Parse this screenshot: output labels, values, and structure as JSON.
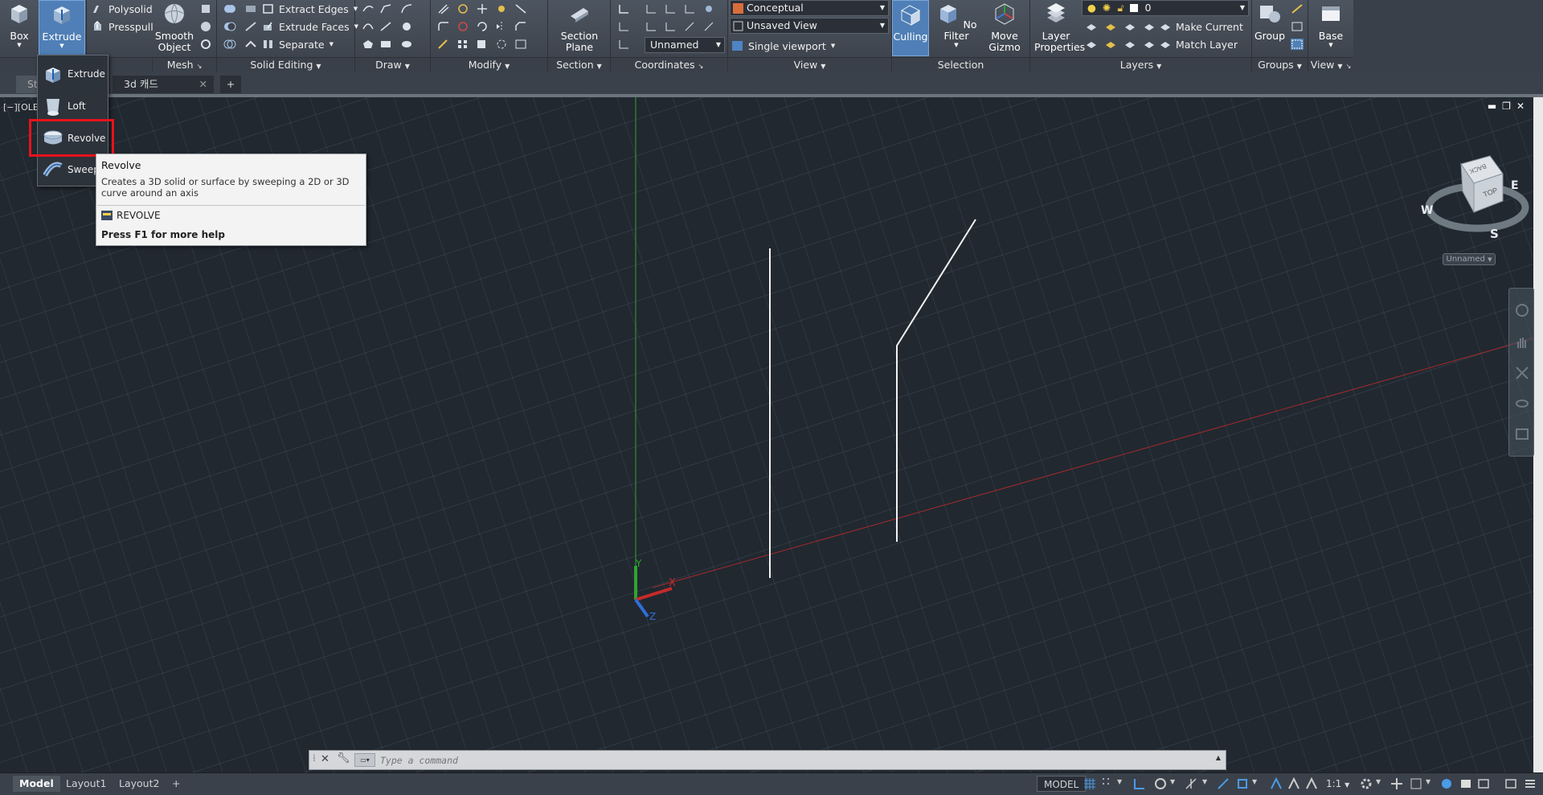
{
  "ribbon": {
    "panels": {
      "modeling": {
        "box_label": "Box",
        "extrude_label": "Extrude",
        "polysolid_label": "Polysolid",
        "presspull_label": "Presspull"
      },
      "mesh": {
        "title": "Mesh",
        "smooth_object_label": "Smooth Object"
      },
      "solid_editing": {
        "title": "Solid Editing",
        "extract_edges_label": "Extract Edges",
        "extrude_faces_label": "Extrude Faces",
        "separate_label": "Separate"
      },
      "draw": {
        "title": "Draw"
      },
      "modify": {
        "title": "Modify"
      },
      "section": {
        "title": "Section",
        "section_plane_label": "Section Plane"
      },
      "coordinates": {
        "title": "Coordinates",
        "ucs_combo": "Unnamed"
      },
      "view": {
        "title": "View",
        "visual_style": "Conceptual",
        "named_view": "Unsaved View",
        "viewport_config": "Single viewport"
      },
      "selection": {
        "title": "Selection",
        "culling_label": "Culling",
        "no_filter_label": "No Filter",
        "move_gizmo_label": "Move Gizmo"
      },
      "layers": {
        "title": "Layers",
        "layer_properties_label": "Layer Properties",
        "current_layer": "0",
        "make_current_label": "Make Current",
        "match_layer_label": "Match Layer"
      },
      "groups": {
        "title": "Groups",
        "group_label": "Group"
      },
      "view2": {
        "title": "View",
        "base_label": "Base"
      }
    }
  },
  "doc_tabs": {
    "start_label": "Start",
    "file_label": "3d 캐드"
  },
  "viewport": {
    "label": "[−][OLE"
  },
  "flyout": {
    "items": [
      "Extrude",
      "Loft",
      "Revolve",
      "Sweep"
    ]
  },
  "tooltip": {
    "title": "Revolve",
    "description": "Creates a 3D solid or surface by sweeping a 2D or 3D curve around an axis",
    "command": "REVOLVE",
    "help": "Press F1 for more help"
  },
  "viewcube": {
    "faces": {
      "top": "TOP",
      "back": "BACK"
    },
    "compass": {
      "west": "W",
      "east": "E",
      "south": "S"
    },
    "ucs_label": "Unnamed"
  },
  "ucs_icon": {
    "x": "X",
    "y": "Y",
    "z": "Z"
  },
  "command_line": {
    "placeholder": "Type a command"
  },
  "status": {
    "layout_tabs": [
      "Model",
      "Layout1",
      "Layout2"
    ],
    "model_button": "MODEL",
    "scale": "1:1"
  },
  "colors": {
    "ribbon_bg": "#3d434c",
    "viewport_bg": "#212830",
    "active_blue": "#4f7fb6",
    "highlight_red": "#e8121a",
    "y_axis_green": "#2ea52e",
    "x_axis_red": "#c62a2a"
  }
}
